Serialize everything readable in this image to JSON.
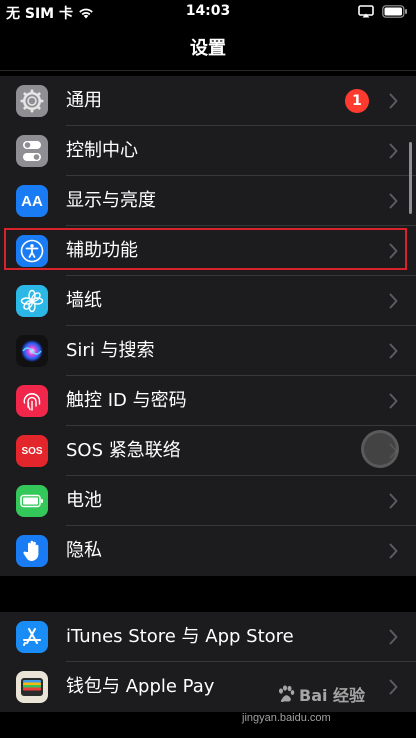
{
  "status_bar": {
    "carrier": "无 SIM 卡",
    "time": "14:03"
  },
  "nav": {
    "title": "设置"
  },
  "group1": [
    {
      "label": "通用",
      "icon": "gear-icon",
      "icon_bg": "#8e8e93",
      "badge": "1"
    },
    {
      "label": "控制中心",
      "icon": "toggle-switches-icon",
      "icon_bg": "#8e8e93"
    },
    {
      "label": "显示与亮度",
      "icon": "aa-text-icon",
      "icon_bg": "#1a7cf5",
      "icon_text": "AA"
    },
    {
      "label": "辅助功能",
      "icon": "accessibility-person-icon",
      "icon_bg": "#1a7cf5"
    },
    {
      "label": "墙纸",
      "icon": "flower-icon",
      "icon_bg": "#2bb8e6"
    },
    {
      "label": "Siri 与搜索",
      "icon": "siri-orb-icon",
      "icon_bg": "#111111"
    },
    {
      "label": "触控 ID 与密码",
      "icon": "fingerprint-icon",
      "icon_bg": "#f0264a"
    },
    {
      "label": "SOS 紧急联络",
      "icon": "sos-icon",
      "icon_bg": "#e3262b",
      "icon_text": "SOS"
    },
    {
      "label": "电池",
      "icon": "battery-icon",
      "icon_bg": "#34c759"
    },
    {
      "label": "隐私",
      "icon": "raised-hand-icon",
      "icon_bg": "#1a7cf5"
    }
  ],
  "group2": [
    {
      "label": "iTunes Store 与 App Store",
      "icon": "app-store-icon",
      "icon_bg": "#1a8cf5"
    },
    {
      "label": "钱包与 Apple Pay",
      "icon": "wallet-icon",
      "icon_bg": "#1c1c1e"
    }
  ],
  "watermark": {
    "brand": "Bai 经验",
    "url": "jingyan.baidu.com"
  },
  "colors": {
    "background": "#000000",
    "cell": "#1c1c1e",
    "highlight_border": "#d8232a",
    "badge": "#ff3b30"
  }
}
